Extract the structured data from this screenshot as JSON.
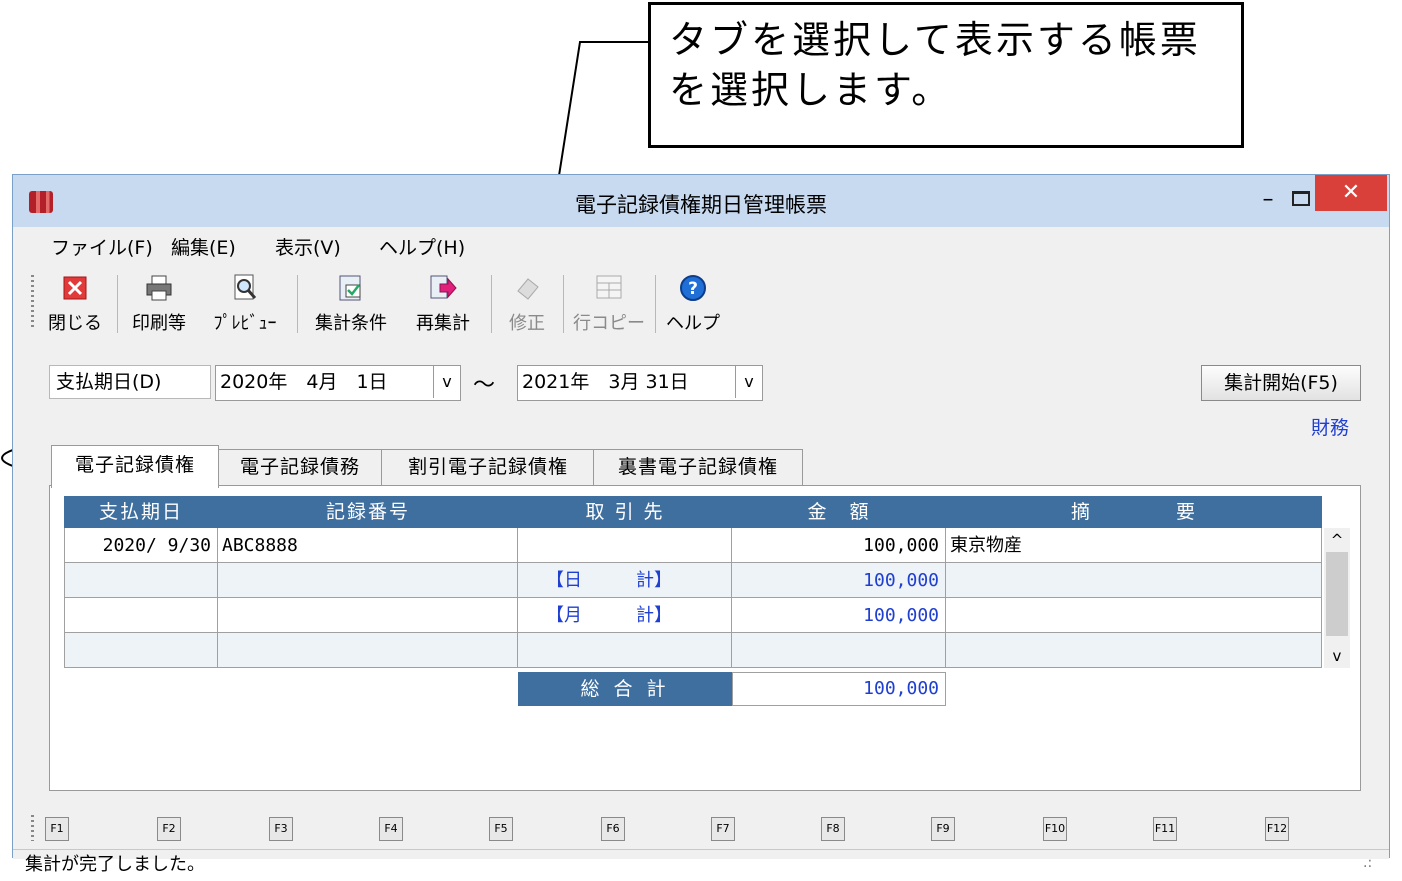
{
  "callout": {
    "line1": "タブを選択して表示する帳票",
    "line2": "を選択します。"
  },
  "window": {
    "title": "電子記録債権期日管理帳票",
    "min_glyph": "–",
    "close_glyph": "✕"
  },
  "menu": [
    "ファイル(F)",
    "編集(E)",
    "表示(V)",
    "ヘルプ(H)"
  ],
  "toolbar": {
    "close": "閉じる",
    "print": "印刷等",
    "preview": "ﾌﾟﾚﾋﾞｭｰ",
    "conditions": "集計条件",
    "recalc": "再集計",
    "edit": "修正",
    "row_copy": "行コピー",
    "help": "ヘルプ"
  },
  "filter": {
    "label": "支払期日(D)",
    "from": "2020年　4月　1日",
    "tilde": "～",
    "to": "2021年　3月 31日",
    "dropdown_glyph": "v",
    "start_button": "集計開始(F5)",
    "zaimu_link": "財務"
  },
  "tabs": [
    "電子記録債権",
    "電子記録債務",
    "割引電子記録債権",
    "裏書電子記録債権"
  ],
  "grid": {
    "headers": [
      "支払期日",
      "記録番号",
      "取 引 先",
      "金　額",
      "摘　　　　要"
    ],
    "rows": [
      [
        "2020/ 9/30",
        "ABC8888",
        "",
        "100,000",
        "東京物産"
      ],
      [
        "",
        "",
        "【日　　　計】",
        "100,000",
        ""
      ],
      [
        "",
        "",
        "【月　　　計】",
        "100,000",
        ""
      ],
      [
        "",
        "",
        "",
        "",
        ""
      ]
    ],
    "total_label": "総 合 計",
    "total_value": "100,000"
  },
  "fkeys": [
    "F1",
    "F2",
    "F3",
    "F4",
    "F5",
    "F6",
    "F7",
    "F8",
    "F9",
    "F10",
    "F11",
    "F12"
  ],
  "status": "集計が完了しました。",
  "colors": {
    "header_blue": "#3f6f9f",
    "close_red": "#d9403a",
    "link_blue": "#1f3fd0"
  }
}
